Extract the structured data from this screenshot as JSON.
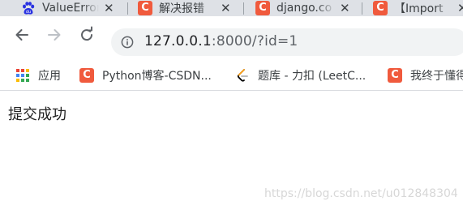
{
  "tabs": [
    {
      "title": "ValueError",
      "icon": "baidu-icon"
    },
    {
      "title": "解决报错",
      "icon": "csdn-icon"
    },
    {
      "title": "django.co",
      "icon": "csdn-icon"
    },
    {
      "title": "【Import",
      "icon": "csdn-icon"
    }
  ],
  "tab_close_glyph": "✕",
  "toolbar": {
    "url_host": "127.0.0.1",
    "url_rest": ":8000/?id=1"
  },
  "bookmarks": [
    {
      "label": "应用",
      "icon": "apps-grid-icon"
    },
    {
      "label": "Python博客-CSDN...",
      "icon": "csdn-icon"
    },
    {
      "label": "题库 - 力扣 (LeetC...",
      "icon": "leetcode-icon"
    },
    {
      "label": "我终于懂得",
      "icon": "csdn-icon"
    }
  ],
  "page": {
    "message": "提交成功",
    "watermark": "https://blog.csdn.net/u012848304"
  },
  "colors": {
    "tabstrip": "#dee1e6",
    "csdn_brand": "#f05a3d",
    "omnibox": "#f1f3f4",
    "text": "#3c4043"
  }
}
